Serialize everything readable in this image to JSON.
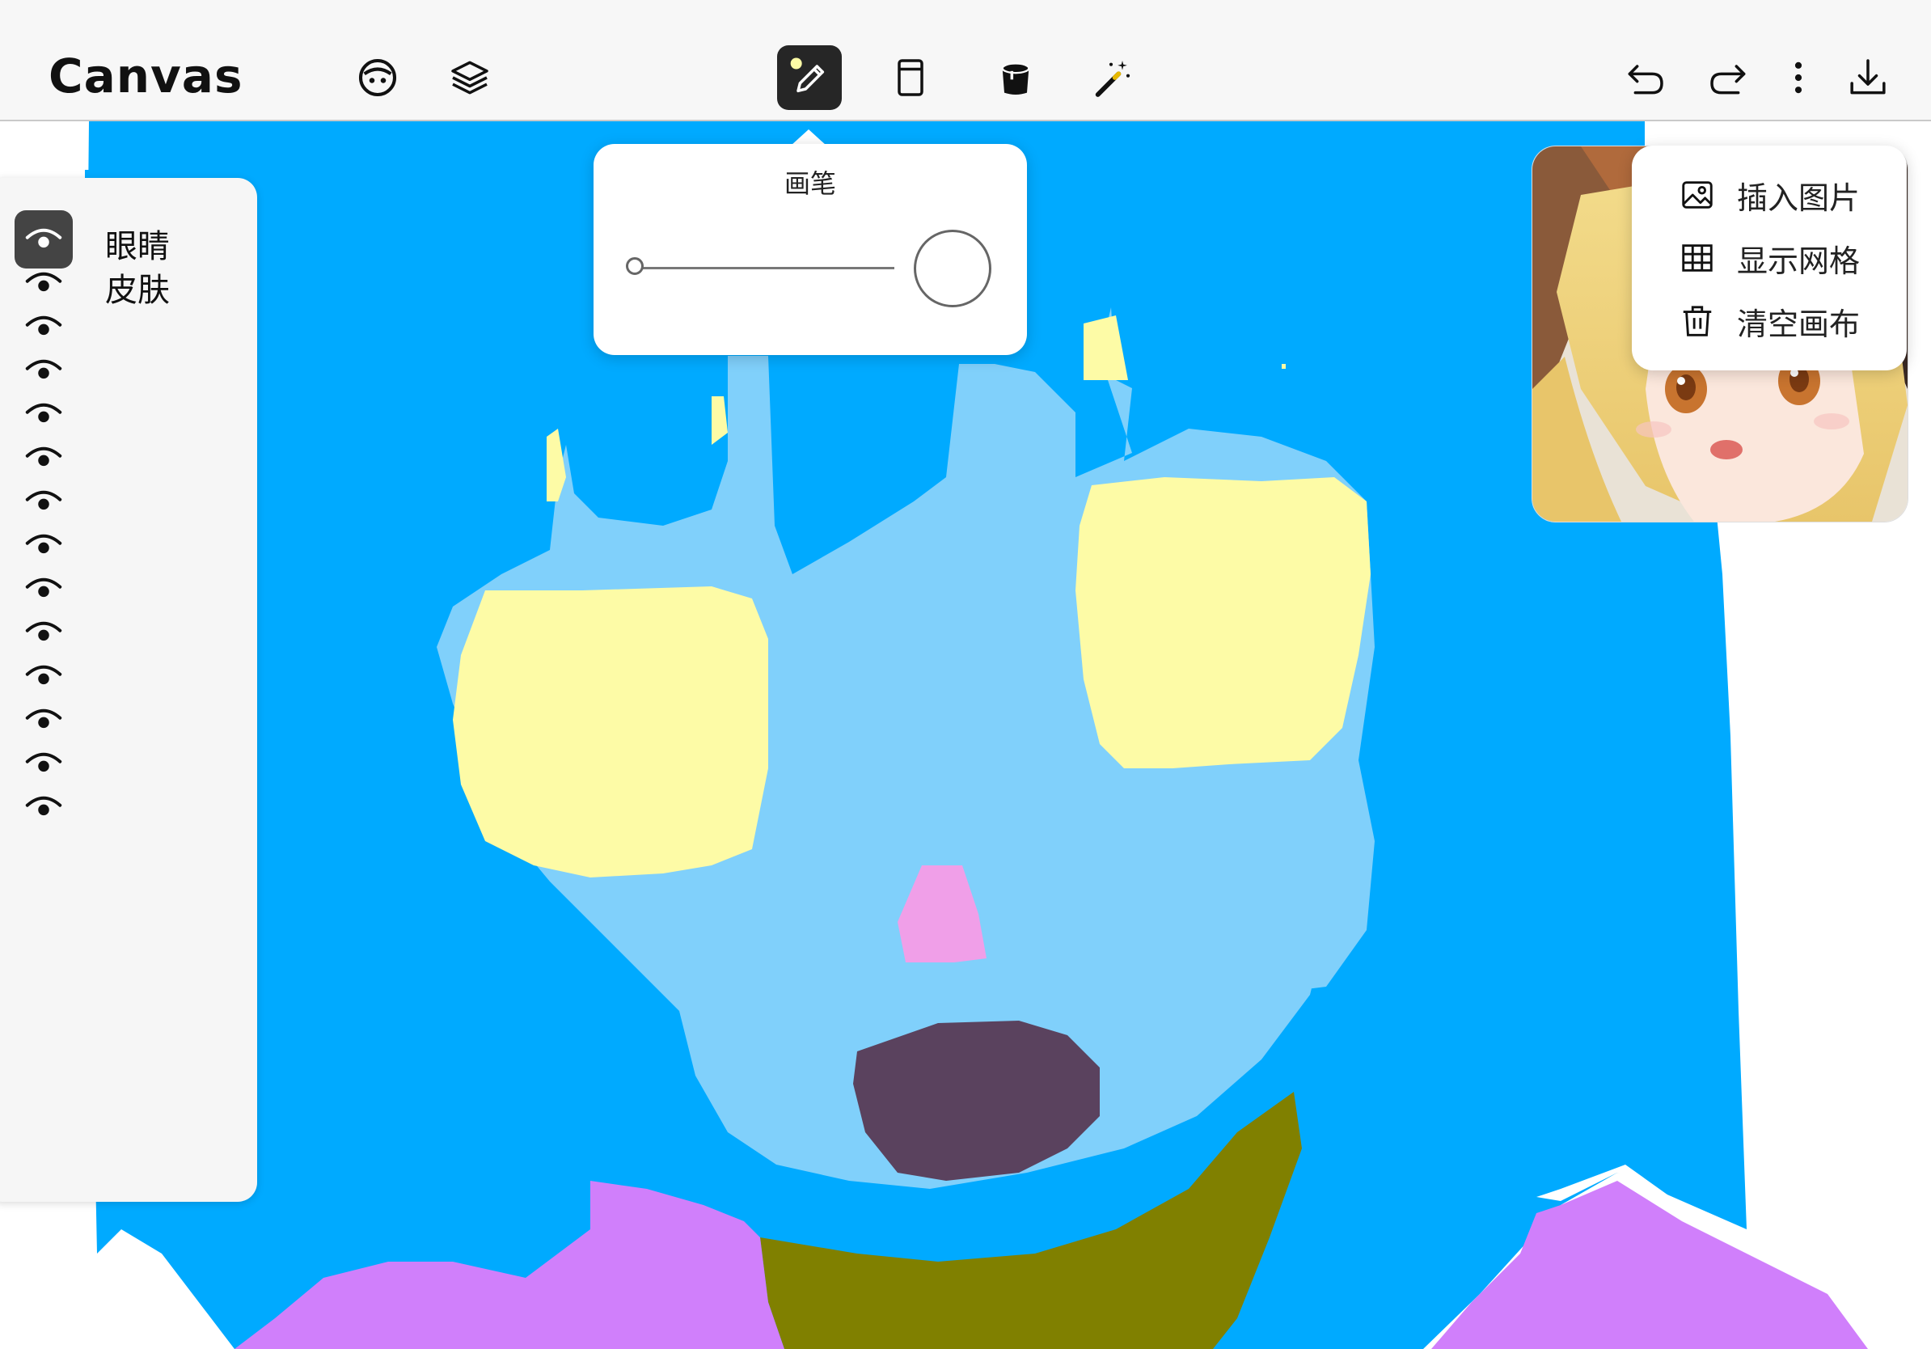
{
  "app": {
    "title": "Canvas"
  },
  "toolbar": {
    "left_tools": [
      {
        "icon": "face-icon"
      },
      {
        "icon": "layers-icon"
      }
    ],
    "center_tools": [
      {
        "icon": "pencil-icon",
        "active": true
      },
      {
        "icon": "canvas-frame-icon",
        "active": false
      },
      {
        "icon": "paint-bucket-icon",
        "active": false
      },
      {
        "icon": "magic-wand-icon",
        "active": false
      }
    ],
    "right_tools": [
      {
        "icon": "undo-icon"
      },
      {
        "icon": "redo-icon"
      },
      {
        "icon": "more-vertical-icon"
      },
      {
        "icon": "download-icon"
      }
    ]
  },
  "brush_popup": {
    "title": "画笔",
    "size_level": 1.0
  },
  "layers": {
    "items": [
      {
        "label": "眼睛",
        "active": true
      },
      {
        "label": "皮肤",
        "active": false
      },
      {
        "label": "",
        "active": false
      },
      {
        "label": "",
        "active": false
      },
      {
        "label": "",
        "active": false
      },
      {
        "label": "",
        "active": false
      },
      {
        "label": "",
        "active": false
      },
      {
        "label": "",
        "active": false
      },
      {
        "label": "",
        "active": false
      },
      {
        "label": "",
        "active": false
      },
      {
        "label": "",
        "active": false
      },
      {
        "label": "",
        "active": false
      },
      {
        "label": "",
        "active": false
      },
      {
        "label": "",
        "active": false
      }
    ]
  },
  "more_menu": {
    "items": [
      {
        "icon": "image-icon",
        "label": "插入图片"
      },
      {
        "icon": "grid-icon",
        "label": "显示网格"
      },
      {
        "icon": "trash-icon",
        "label": "清空画布"
      }
    ]
  },
  "colors": {
    "hair": "#00aaff",
    "skin": "#80d0fb",
    "eyes": "#fdfba6",
    "nose": "#f09fe8",
    "mouth": "#5a425e",
    "clothes": "#d07ffb",
    "neck": "#808000",
    "accent_dark": "#262626"
  }
}
